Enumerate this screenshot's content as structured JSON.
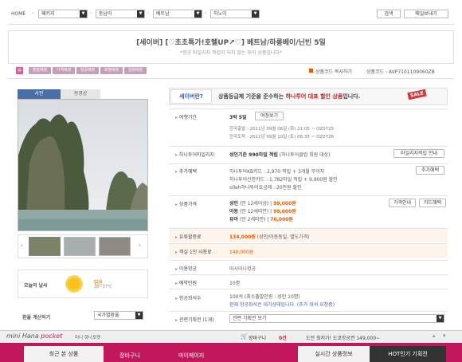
{
  "nav": {
    "home": "HOME",
    "sel1": "패키지",
    "sel2": "동남아",
    "sel3": "베트남",
    "sel4": "하노이",
    "search": "검색",
    "my": "메일보내기"
  },
  "header": {
    "title": "[세이버] [♡초초특가!호텔UP↗♡] 베트남/하롱베이/닌빈 5일",
    "subtitle": "*항공 마일리지 적립이 되지 않는 투어 상품입니다*"
  },
  "tabs": [
    "출발예정",
    "가격예정",
    "항공예정",
    "호텔예정",
    "일정예정"
  ],
  "product": {
    "copy": "상품코드 복사하기",
    "code": "상품코드 : AVP7101109060ZB"
  },
  "photo_tabs": [
    "사진",
    "동영상"
  ],
  "weather": {
    "label": "오늘의 날씨",
    "status": "맑음",
    "temp": "28~37℃"
  },
  "exchange": {
    "label": "환율 계산하기",
    "select": "국가별환율"
  },
  "saver": {
    "badge": "세이버란?",
    "text1": "상품등급제 기준을 준수하는 ",
    "text2": "하나투어 대표 할인 상품",
    "text3": "입니다.",
    "sale": "SALE"
  },
  "period": {
    "label": "여행기간",
    "value": "3박 5일",
    "btn": "여정보기",
    "dep": "한국출발 : 2011년 09월 06일 (화) 21:05 ~ OZ0725",
    "arr": "한국도착 : 2011년 09월 10일 (토) 06:35 ~ OZ0726"
  },
  "mileage": {
    "label": "하나투어마일리지",
    "value": "성인기준 990마일 적립",
    "note": " (하나투어클럽 회원 대상)",
    "btn": "마일리지적립 안내"
  },
  "benefit": {
    "label": "추가혜택",
    "l1": "하나투어KB카드 : 2,970 적립 + 3개월 무이자",
    "l2": "하나투어신한카드 : 1,782마일 적립 + 9,900원 할인",
    "l3": "olleh하나투어요금제 : 20만원 할인",
    "btn": "추가혜택"
  },
  "price": {
    "label": "상품가격",
    "adult": "성인",
    "adult_note": " (만 12세이상) | ",
    "adult_price": "99,000원",
    "child": "아동",
    "child_note": " (만 12세미만) | ",
    "child_price": "99,000원",
    "infant": "유아",
    "infant_note": " (만 2세미만) | ",
    "infant_price": "70,000원",
    "btn1": "가격안내",
    "btn2": "카드혜택"
  },
  "fuel": {
    "label": "유류할증료",
    "value": "134,000원",
    "note": " (성인/아동동일, 별도가격)"
  },
  "single": {
    "label": "객실 1인 사용료",
    "value": "140,000원"
  },
  "airline": {
    "label": "이용항공",
    "value": "아시아나항공"
  },
  "reserve": {
    "label": "예약인원",
    "value": "10명"
  },
  "seats": {
    "label": "항공좌석수",
    "l1": "100석 (최소출발인원 : 성인 10명)",
    "l2": "현재 항공좌석은 대기상태입니다. (추가 좌석 요청중)"
  },
  "related": {
    "label": "관련기획전 (1개)",
    "select": "관련 기획전 보기"
  },
  "pocket": {
    "brand1": "mini Hana ",
    "brand2": "pocket",
    "sub": "미니 하나포켓",
    "cart": "장바구니",
    "cart_count": "0건",
    "deal": "도전 최저가! 도쿄항공권 149,000~"
  },
  "bottom": [
    "최근 본 상품",
    "장바구니",
    "마이페이지"
  ],
  "bottom_right": [
    "실시간 상품정보",
    "HOT인기 기획전"
  ]
}
